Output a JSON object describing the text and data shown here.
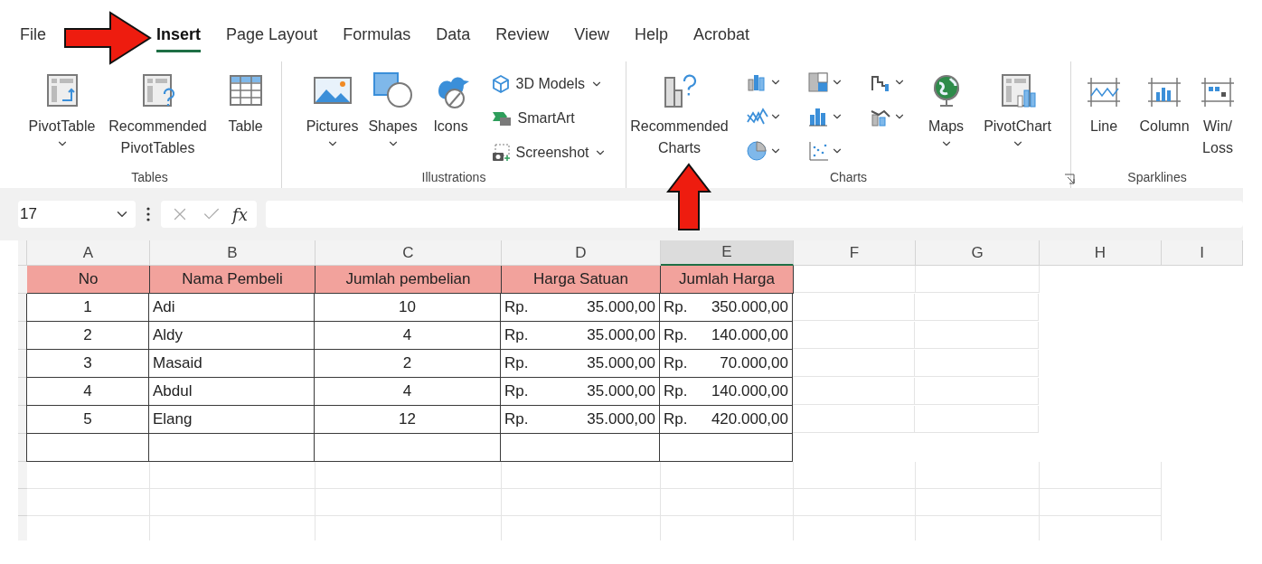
{
  "menu": [
    {
      "label": "File",
      "selected": false
    },
    {
      "label": "Insert",
      "selected": true
    },
    {
      "label": "Page Layout",
      "selected": false
    },
    {
      "label": "Formulas",
      "selected": false
    },
    {
      "label": "Data",
      "selected": false
    },
    {
      "label": "Review",
      "selected": false
    },
    {
      "label": "View",
      "selected": false
    },
    {
      "label": "Help",
      "selected": false
    },
    {
      "label": "Acrobat",
      "selected": false
    }
  ],
  "ribbon": {
    "tables": {
      "name": "Tables",
      "buttons": [
        {
          "lines": [
            "PivotTable"
          ],
          "dropdown": true
        },
        {
          "lines": [
            "Recommended",
            "PivotTables"
          ],
          "dropdown": false
        },
        {
          "lines": [
            "Table"
          ],
          "dropdown": false
        }
      ]
    },
    "illustrations": {
      "name": "Illustrations",
      "buttons": [
        {
          "lines": [
            "Pictures"
          ],
          "dropdown": true
        },
        {
          "lines": [
            "Shapes"
          ],
          "dropdown": true
        },
        {
          "lines": [
            "Icons"
          ],
          "dropdown": false
        }
      ],
      "small_buttons": [
        {
          "label": "3D Models",
          "dropdown": true
        },
        {
          "label": "SmartArt",
          "dropdown": false
        },
        {
          "label": "Screenshot",
          "dropdown": true
        }
      ]
    },
    "charts": {
      "name": "Charts",
      "recommended": {
        "lines": [
          "Recommended",
          "Charts"
        ]
      },
      "buttons": [
        {
          "lines": [
            "Maps"
          ],
          "dropdown": true
        },
        {
          "lines": [
            "PivotChart"
          ],
          "dropdown": true
        }
      ]
    },
    "sparklines": {
      "name": "Sparklines",
      "buttons": [
        {
          "lines": [
            "Line"
          ]
        },
        {
          "lines": [
            "Column"
          ]
        },
        {
          "lines": [
            "Win/",
            "Loss"
          ]
        }
      ]
    }
  },
  "formula_bar": {
    "name_box": "17",
    "function_button": "fx"
  },
  "column_headers": [
    {
      "label": "A",
      "selected": false
    },
    {
      "label": "B",
      "selected": false
    },
    {
      "label": "C",
      "selected": false
    },
    {
      "label": "D",
      "selected": false
    },
    {
      "label": "E",
      "selected": true
    },
    {
      "label": "F",
      "selected": false
    },
    {
      "label": "G",
      "selected": false
    },
    {
      "label": "H",
      "selected": false
    },
    {
      "label": "I",
      "selected": false
    }
  ],
  "table": {
    "columns": [
      "No",
      "Nama Pembeli",
      "Jumlah pembelian",
      "Harga Satuan",
      "Jumlah Harga"
    ],
    "rows": [
      {
        "no": "1",
        "name": "Adi",
        "qty": "10",
        "price": {
          "currency": "Rp.",
          "amount": "35.000,00"
        },
        "total": {
          "currency": "Rp.",
          "amount": "350.000,00"
        }
      },
      {
        "no": "2",
        "name": "Aldy",
        "qty": "4",
        "price": {
          "currency": "Rp.",
          "amount": "35.000,00"
        },
        "total": {
          "currency": "Rp.",
          "amount": "140.000,00"
        }
      },
      {
        "no": "3",
        "name": "Masaid",
        "qty": "2",
        "price": {
          "currency": "Rp.",
          "amount": "35.000,00"
        },
        "total": {
          "currency": "Rp.",
          "amount": "70.000,00"
        }
      },
      {
        "no": "4",
        "name": "Abdul",
        "qty": "4",
        "price": {
          "currency": "Rp.",
          "amount": "35.000,00"
        },
        "total": {
          "currency": "Rp.",
          "amount": "140.000,00"
        }
      },
      {
        "no": "5",
        "name": "Elang",
        "qty": "12",
        "price": {
          "currency": "Rp.",
          "amount": "35.000,00"
        },
        "total": {
          "currency": "Rp.",
          "amount": "420.000,00"
        }
      }
    ]
  }
}
